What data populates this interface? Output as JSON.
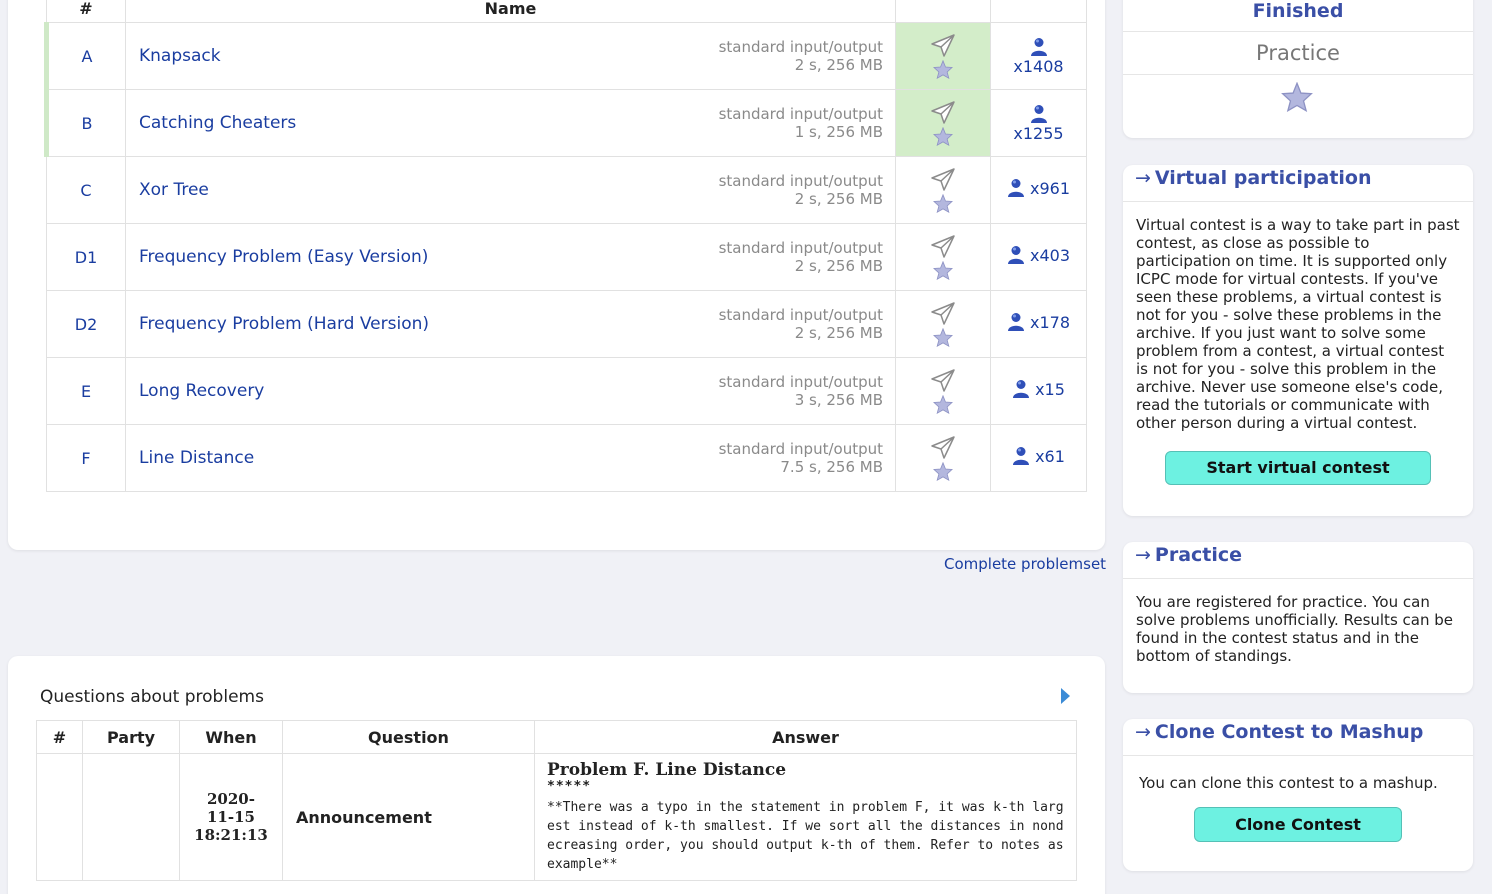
{
  "problems": {
    "headers": {
      "index": "#",
      "name": "Name"
    },
    "rows": [
      {
        "index": "A",
        "name": "Knapsack",
        "io": "standard input/output",
        "limits": "2 s, 256 MB",
        "solved": "x1408",
        "accepted": true
      },
      {
        "index": "B",
        "name": "Catching Cheaters",
        "io": "standard input/output",
        "limits": "1 s, 256 MB",
        "solved": "x1255",
        "accepted": true
      },
      {
        "index": "C",
        "name": "Xor Tree",
        "io": "standard input/output",
        "limits": "2 s, 256 MB",
        "solved": "x961",
        "accepted": false
      },
      {
        "index": "D1",
        "name": "Frequency Problem (Easy Version)",
        "io": "standard input/output",
        "limits": "2 s, 256 MB",
        "solved": "x403",
        "accepted": false
      },
      {
        "index": "D2",
        "name": "Frequency Problem (Hard Version)",
        "io": "standard input/output",
        "limits": "2 s, 256 MB",
        "solved": "x178",
        "accepted": false
      },
      {
        "index": "E",
        "name": "Long Recovery",
        "io": "standard input/output",
        "limits": "3 s, 256 MB",
        "solved": "x15",
        "accepted": false
      },
      {
        "index": "F",
        "name": "Line Distance",
        "io": "standard input/output",
        "limits": "7.5 s, 256 MB",
        "solved": "x61",
        "accepted": false
      }
    ],
    "complete_link": "Complete problemset"
  },
  "questions": {
    "title": "Questions about problems",
    "headers": {
      "index": "#",
      "party": "Party",
      "when": "When",
      "question": "Question",
      "answer": "Answer"
    },
    "rows": [
      {
        "index": "",
        "party": "",
        "when": [
          "2020-",
          "11-15",
          "18:21:13"
        ],
        "question": "Announcement",
        "answer_title": "Problem F. Line Distance",
        "answer_stars": "*****",
        "answer_body": "**There was a typo in the statement in problem F, it was k-th largest instead of k-th smallest. If we sort all the distances in nondecreasing order, you should output k-th of them. Refer to notes as example**"
      }
    ]
  },
  "sidebar": {
    "status": "Finished",
    "practice_label": "Practice",
    "virtual": {
      "arrow": "→",
      "title": "Virtual participation",
      "text": "Virtual contest is a way to take part in past contest, as close as possible to participation on time. It is supported only ICPC mode for virtual contests. If you've seen these problems, a virtual contest is not for you - solve these problems in the archive. If you just want to solve some problem from a contest, a virtual contest is not for you - solve this problem in the archive. Never use someone else's code, read the tutorials or communicate with other person during a virtual contest.",
      "button": "Start virtual contest"
    },
    "practice": {
      "arrow": "→",
      "title": "Practice",
      "text": "You are registered for practice. You can solve problems unofficially. Results can be found in the contest status and in the bottom of standings."
    },
    "clone": {
      "arrow": "→",
      "title": "Clone Contest to Mashup",
      "text": "You can clone this contest to a mashup.",
      "button": "Clone Contest"
    }
  },
  "icons": {
    "submit": "paper-plane-icon",
    "favourite": "star-icon",
    "solvers": "user-icon",
    "expand": "triangle-right-icon"
  },
  "colors": {
    "link": "#1a3da0",
    "accepted_bg": "#d3edc9",
    "accepted_border": "#cfe9c7",
    "button_bg": "#6df1e1",
    "sidebar_title": "#3a4fa6"
  }
}
